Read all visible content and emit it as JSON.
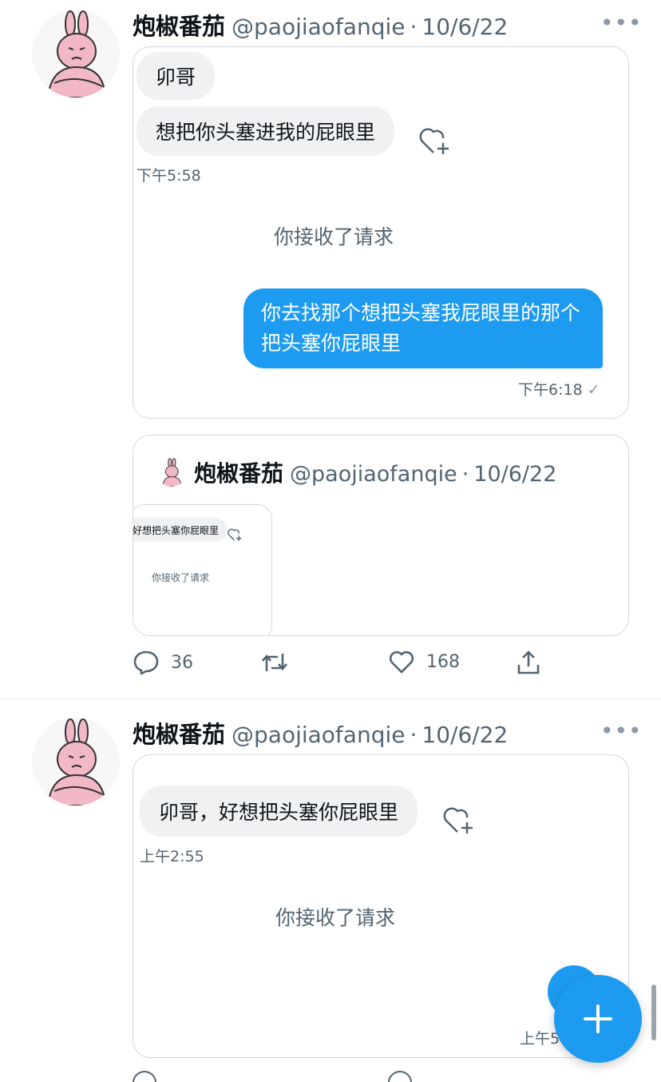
{
  "tweets": [
    {
      "display_name": "炮椒番茄",
      "handle": "@paojiaofanqie",
      "separator": "·",
      "date": "10/6/22",
      "more_glyph": "•••",
      "chat": {
        "incoming_1": "卯哥",
        "incoming_2": "想把你头塞进我的屁眼里",
        "incoming_time": "下午5:58",
        "system_message": "你接收了请求",
        "outgoing": "你去找那个想把头塞我屁眼里的那个把头塞你屁眼里",
        "outgoing_time": "下午6:18"
      },
      "quote": {
        "display_name": "炮椒番茄",
        "handle": "@paojiaofanqie",
        "separator": "·",
        "date": "10/6/22",
        "thumb_bubble": "好想把头塞你屁眼里",
        "thumb_system": "你接收了请求"
      },
      "actions": {
        "replies": "36",
        "likes": "168"
      }
    },
    {
      "display_name": "炮椒番茄",
      "handle": "@paojiaofanqie",
      "separator": "·",
      "date": "10/6/22",
      "more_glyph": "•••",
      "chat": {
        "incoming_1": "卯哥，好想把头塞你屁眼里",
        "incoming_time": "上午2:55",
        "system_message": "你接收了请求",
        "partial_time": "上午5"
      }
    }
  ],
  "icons": [
    "avatar",
    "heart-plus-icon",
    "reply-icon",
    "retweet-icon",
    "like-icon",
    "share-icon",
    "more-icon",
    "plus-icon"
  ],
  "colors": {
    "accent": "#1d9bf0",
    "bubble_in": "#eff1f3",
    "text_secondary": "#536471",
    "avatar_pink": "#f2b8c6"
  }
}
